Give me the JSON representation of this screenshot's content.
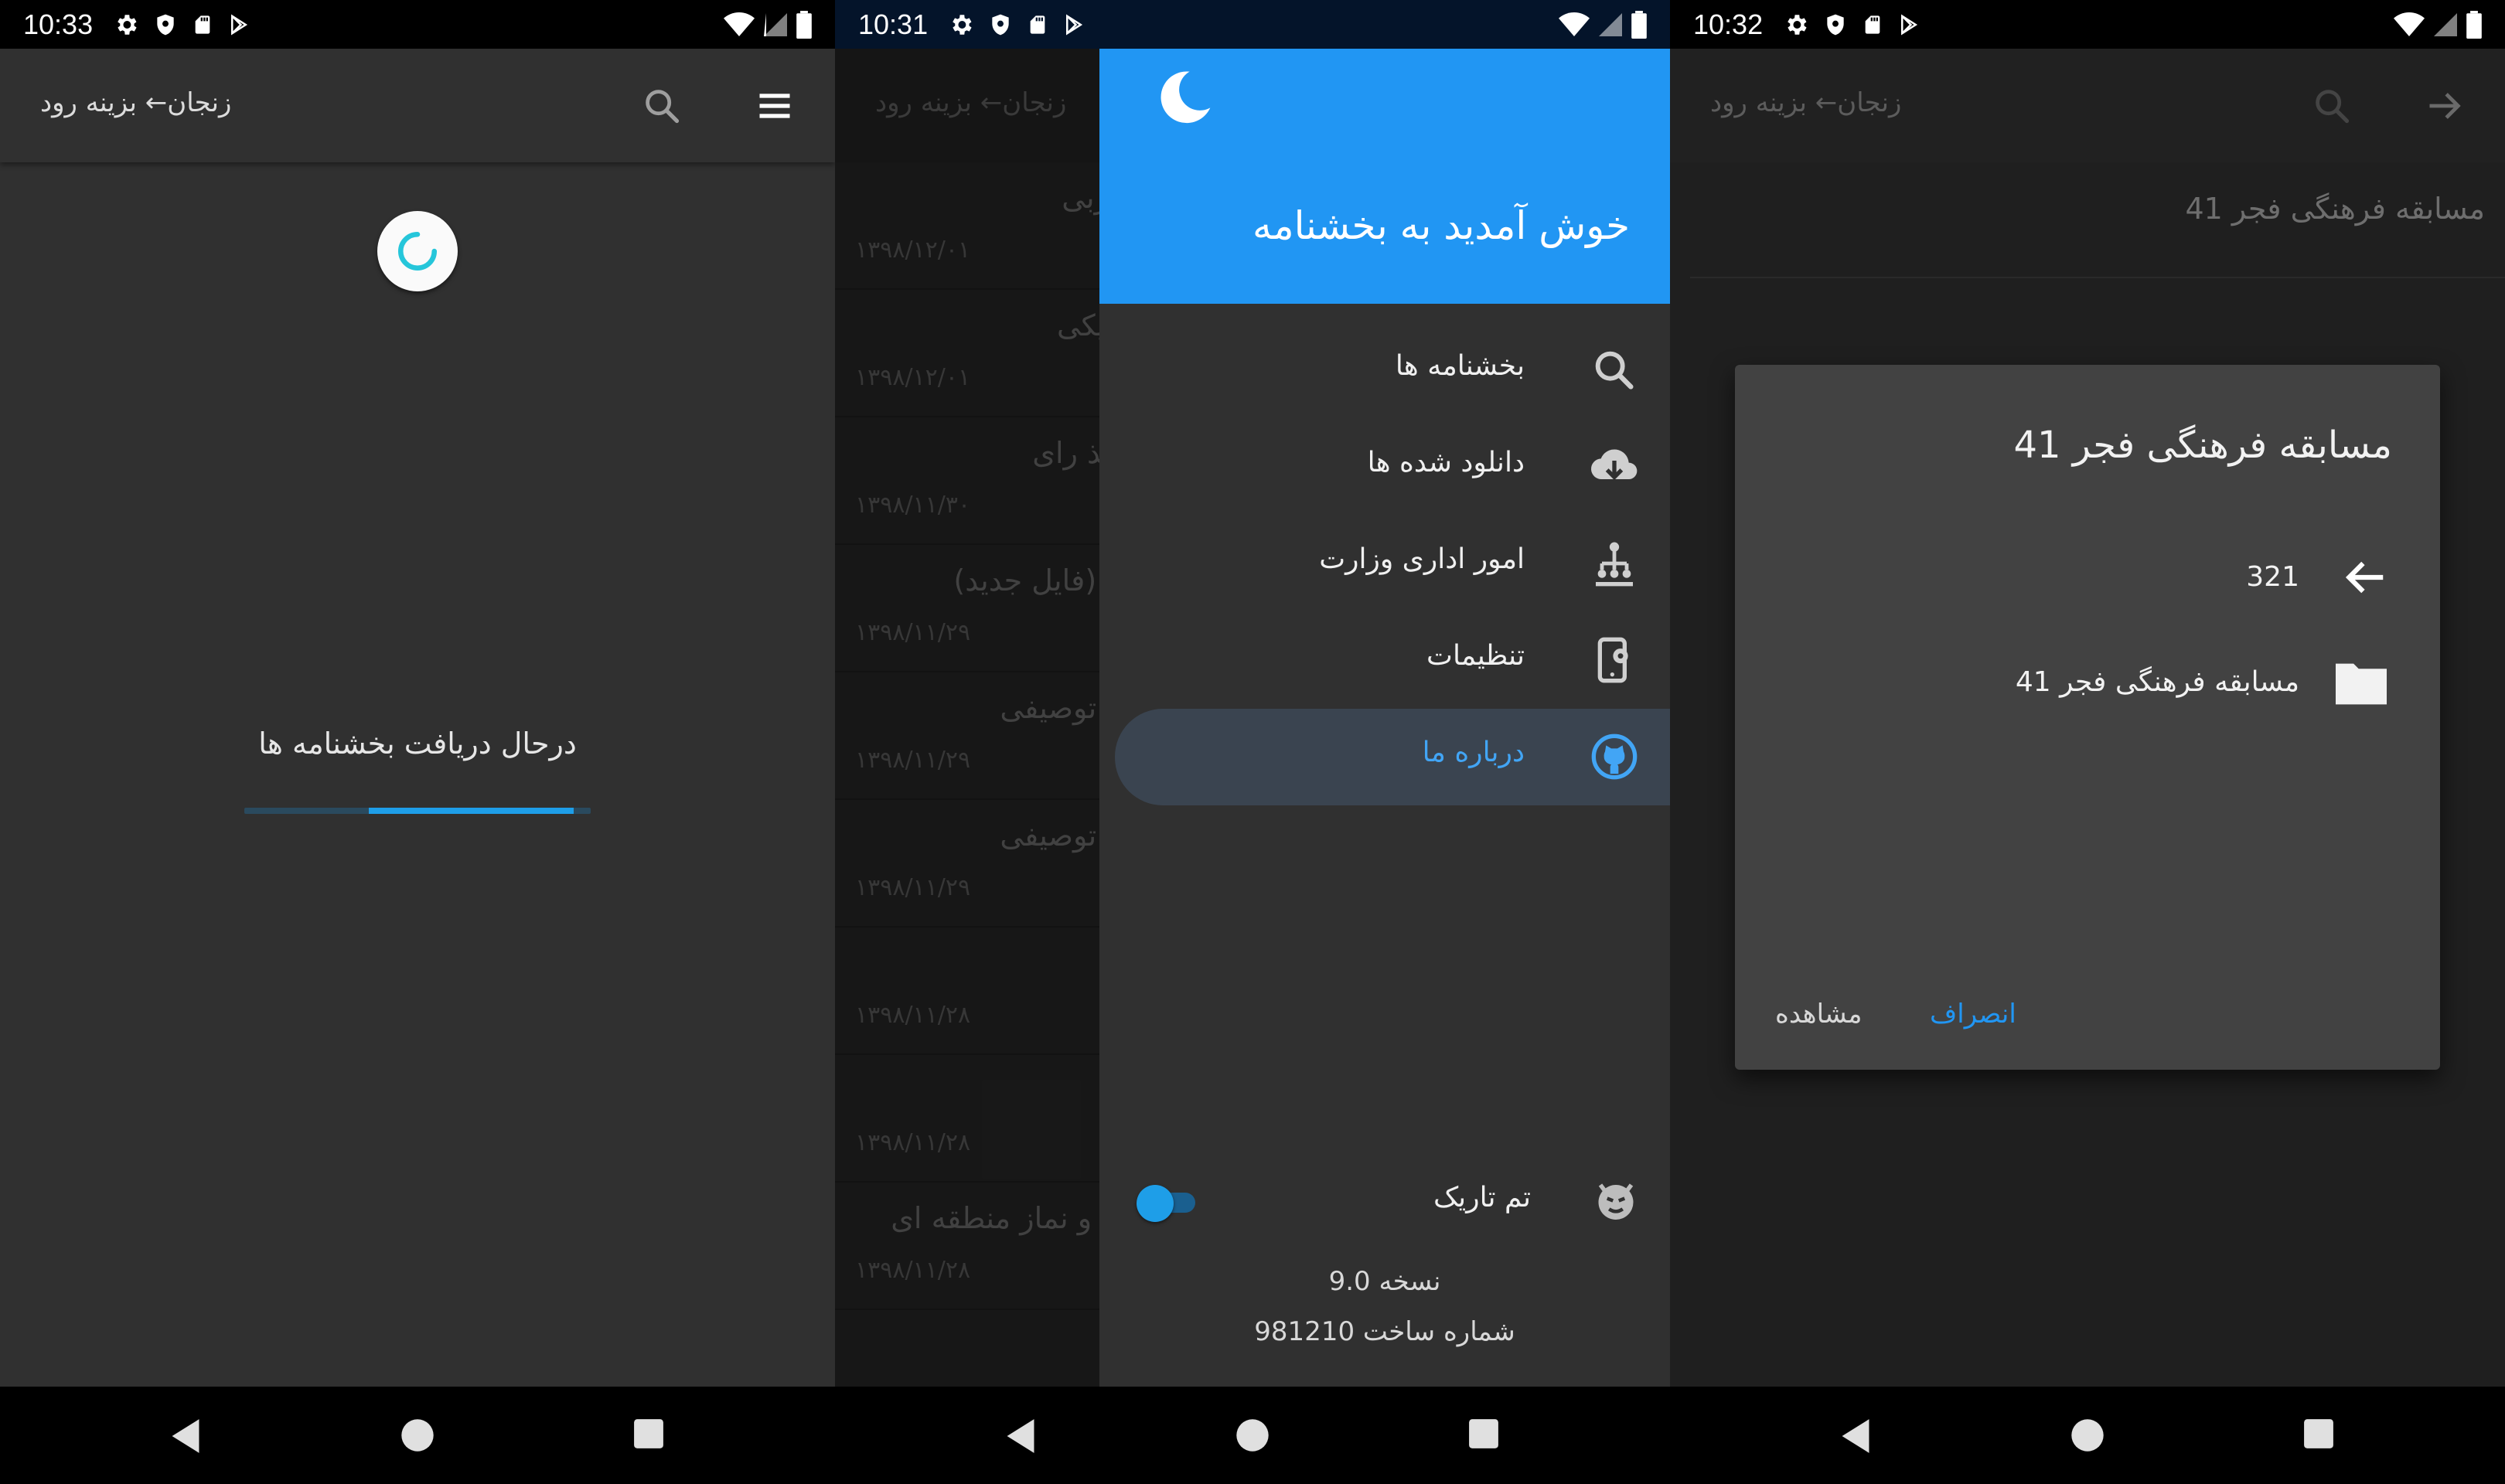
{
  "screens": [
    {
      "status": {
        "time": "10:33"
      },
      "appbar": {
        "title": "زنجان← بزینه رود"
      },
      "loading": {
        "text": "درحال دریافت بخشنامه ها",
        "progress_start": 0.36,
        "progress_end": 0.95
      }
    },
    {
      "status": {
        "time": "10:31"
      },
      "appbar": {
        "title": "زنجان← بزینه رود"
      },
      "background_items": [
        {
          "title": "جربی",
          "date": "۱۳۹۸/۱۲/۰۱"
        },
        {
          "title": "ونیکی",
          "date": "۱۳۹۸/۱۲/۰۱"
        },
        {
          "title": "اخذ رای",
          "date": "۱۳۹۸/۱۱/۳۰"
        },
        {
          "title": "ی (فایل جدید)",
          "date": "۱۳۹۸/۱۱/۲۹"
        },
        {
          "title": "ی توصیفی",
          "date": "۱۳۹۸/۱۱/۲۹"
        },
        {
          "title": "ی توصیفی",
          "date": "۱۳۹۸/۱۱/۲۹"
        },
        {
          "title": "",
          "date": "۱۳۹۸/۱۱/۲۸"
        },
        {
          "title": "",
          "date": "۱۳۹۸/۱۱/۲۸"
        },
        {
          "title": "ت و نماز منطقه ای",
          "date": "۱۳۹۸/۱۱/۲۸"
        }
      ],
      "drawer": {
        "welcome": "خوش آمدید به بخشنامه",
        "items": [
          {
            "label": "بخشنامه ها",
            "icon": "search-icon"
          },
          {
            "label": "دانلود شده ها",
            "icon": "cloud-download-icon"
          },
          {
            "label": "امور اداری وزارت",
            "icon": "sitemap-icon"
          },
          {
            "label": "تنظیمات",
            "icon": "settings-phone-icon"
          },
          {
            "label": "درباره ما",
            "icon": "github-icon",
            "active": true
          }
        ],
        "dark_theme_label": "تم تاریک",
        "dark_theme_on": true,
        "version": "نسخه 9.0",
        "build": "شماره ساخت 981210"
      }
    },
    {
      "status": {
        "time": "10:32"
      },
      "appbar": {
        "title": "زنجان← بزینه رود"
      },
      "header": "مسابقه فرهنگی فجر 41",
      "dialog": {
        "title": "مسابقه فرهنگی فجر 41",
        "back_row": "321",
        "folder_row": "مسابقه فرهنگی فجر 41",
        "cancel": "انصراف",
        "view": "مشاهده"
      }
    }
  ],
  "colors": {
    "accent": "#2196f3",
    "surface": "#303030",
    "dialog": "#424242"
  }
}
